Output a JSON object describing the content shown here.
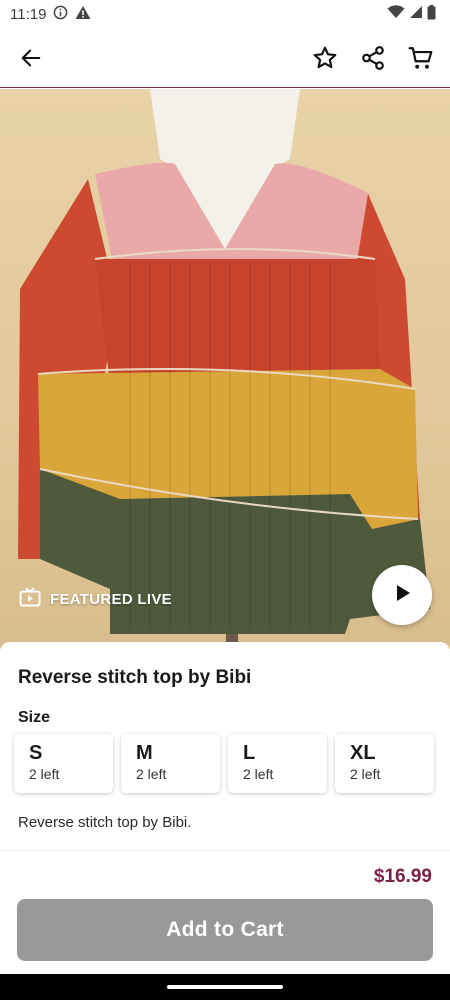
{
  "status_bar": {
    "time": "11:19",
    "icons": [
      "info-icon",
      "warning-icon",
      "wifi-icon",
      "signal-icon",
      "battery-icon"
    ]
  },
  "app_bar": {
    "icons": [
      "back-arrow-icon",
      "star-icon",
      "share-icon",
      "cart-icon"
    ]
  },
  "hero": {
    "badge_icon": "tv-icon",
    "badge_label": "FEATURED LIVE",
    "play_icon": "play-icon"
  },
  "product": {
    "title": "Reverse stitch top by Bibi",
    "size_label": "Size",
    "sizes": [
      {
        "name": "S",
        "stock": "2 left"
      },
      {
        "name": "M",
        "stock": "2 left"
      },
      {
        "name": "L",
        "stock": "2 left"
      },
      {
        "name": "XL",
        "stock": "2 left"
      }
    ],
    "description": "Reverse stitch top by Bibi.",
    "price": "$16.99",
    "add_to_cart_label": "Add to Cart"
  },
  "colors": {
    "accent": "#7a1f48",
    "button_disabled": "#999999"
  }
}
